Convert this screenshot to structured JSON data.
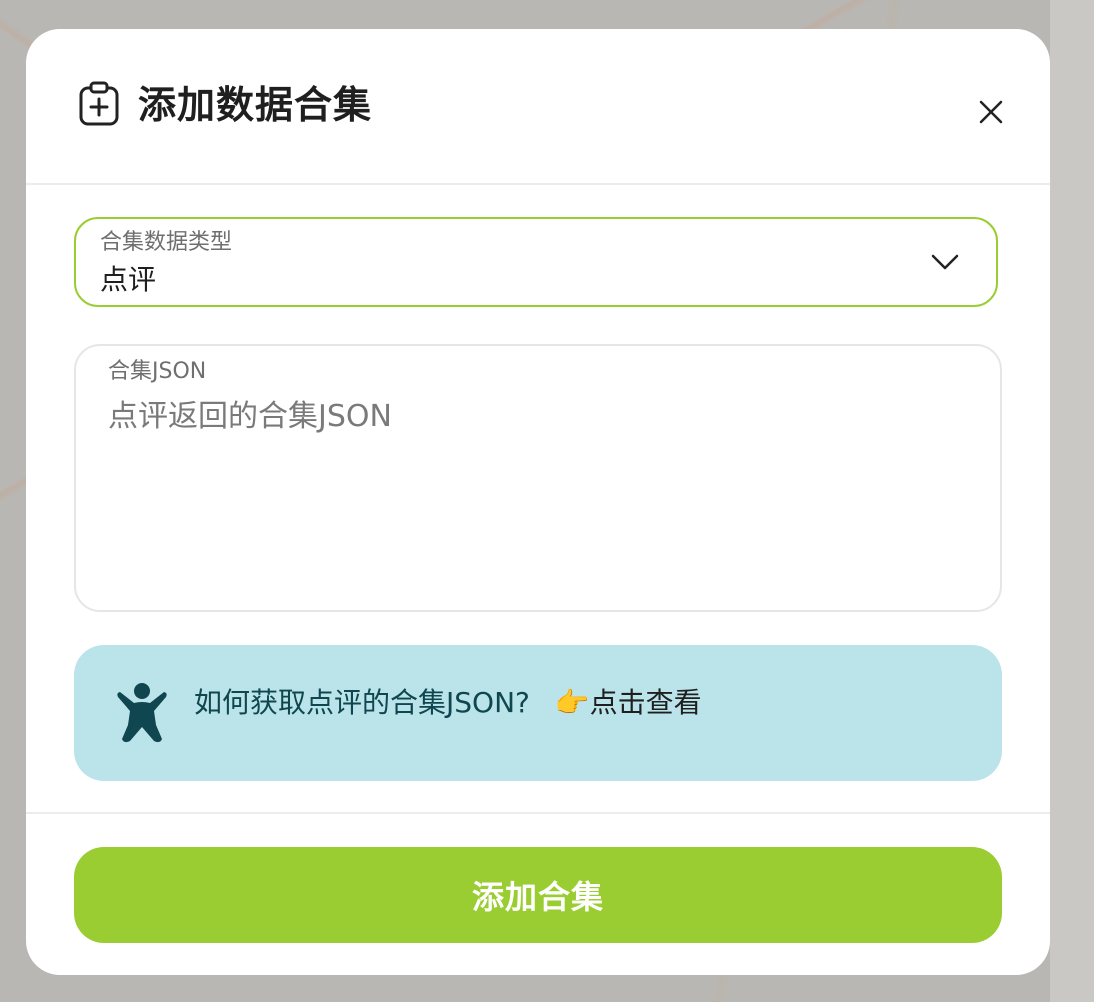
{
  "dialog": {
    "title": "添加数据合集",
    "header_icon": "clipboard-plus-icon",
    "close_icon": "close-icon"
  },
  "type_select": {
    "label": "合集数据类型",
    "value": "点评",
    "icon": "chevron-down-icon"
  },
  "json_field": {
    "label": "合集JSON",
    "placeholder": "点评返回的合集JSON",
    "value": ""
  },
  "help": {
    "icon": "person-figure-icon",
    "text": "如何获取点评的合集JSON?",
    "pointer_emoji": "👉",
    "link_text": "点击查看"
  },
  "submit": {
    "label": "添加合集"
  },
  "colors": {
    "accent": "#9acd32",
    "help_background": "#bae4ea",
    "help_text": "#0f4650",
    "overlay": "#b5b5b3"
  }
}
